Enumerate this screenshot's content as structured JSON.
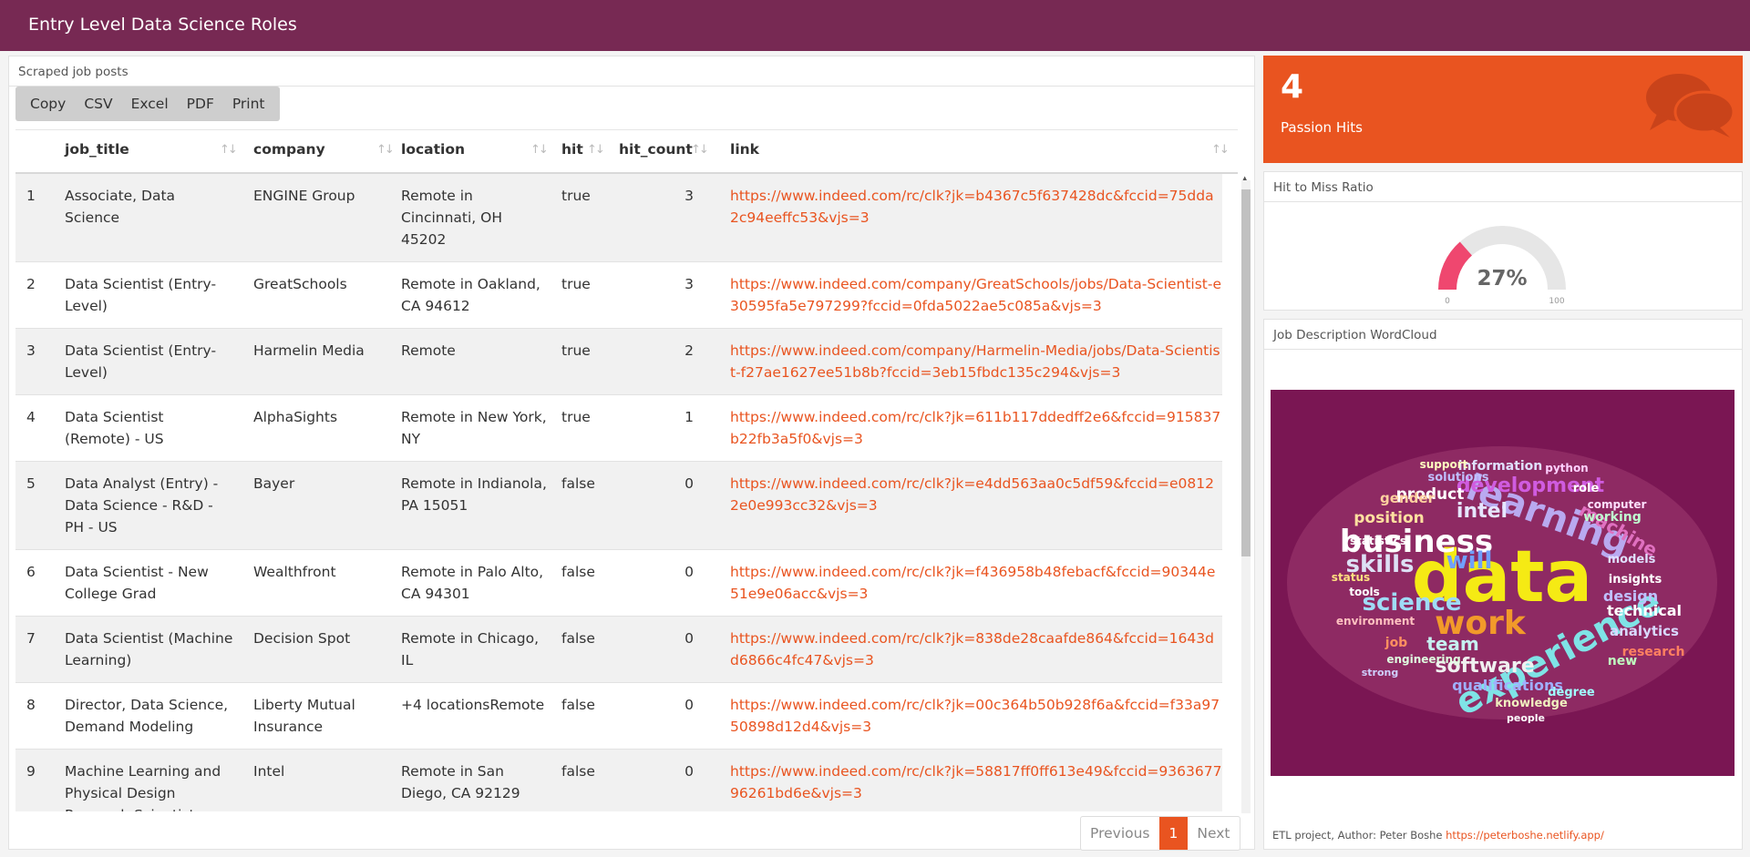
{
  "header": {
    "title": "Entry Level Data Science Roles"
  },
  "table_panel": {
    "title": "Scraped job posts",
    "buttons": [
      "Copy",
      "CSV",
      "Excel",
      "PDF",
      "Print"
    ],
    "columns": [
      "job_title",
      "company",
      "location",
      "hit",
      "hit_count",
      "link"
    ],
    "rows": [
      {
        "idx": "1",
        "job_title": "Associate, Data Science",
        "company": "ENGINE Group",
        "location": "Remote in Cincinnati, OH 45202",
        "hit": "true",
        "hit_count": "3",
        "link": "https://www.indeed.com/rc/clk?jk=b4367c5f637428dc&fccid=75dda2c94eeffc53&vjs=3"
      },
      {
        "idx": "2",
        "job_title": "Data Scientist (Entry-Level)",
        "company": "GreatSchools",
        "location": "Remote in Oakland, CA 94612",
        "hit": "true",
        "hit_count": "3",
        "link": "https://www.indeed.com/company/GreatSchools/jobs/Data-Scientist-e30595fa5e797299?fccid=0fda5022ae5c085a&vjs=3"
      },
      {
        "idx": "3",
        "job_title": "Data Scientist (Entry-Level)",
        "company": "Harmelin Media",
        "location": "Remote",
        "hit": "true",
        "hit_count": "2",
        "link": "https://www.indeed.com/company/Harmelin-Media/jobs/Data-Scientist-f27ae1627ee51b8b?fccid=3eb15fbdc135c294&vjs=3"
      },
      {
        "idx": "4",
        "job_title": "Data Scientist (Remote) - US",
        "company": "AlphaSights",
        "location": "Remote in New York, NY",
        "hit": "true",
        "hit_count": "1",
        "link": "https://www.indeed.com/rc/clk?jk=611b117ddedff2e6&fccid=915837b22fb3a5f0&vjs=3"
      },
      {
        "idx": "5",
        "job_title": "Data Analyst (Entry) - Data Science - R&D - PH - US",
        "company": "Bayer",
        "location": "Remote in Indianola, PA 15051",
        "hit": "false",
        "hit_count": "0",
        "link": "https://www.indeed.com/rc/clk?jk=e4dd563aa0c5df59&fccid=e08122e0e993cc32&vjs=3"
      },
      {
        "idx": "6",
        "job_title": "Data Scientist - New College Grad",
        "company": "Wealthfront",
        "location": "Remote in Palo Alto, CA 94301",
        "hit": "false",
        "hit_count": "0",
        "link": "https://www.indeed.com/rc/clk?jk=f436958b48febacf&fccid=90344e51e9e06acc&vjs=3"
      },
      {
        "idx": "7",
        "job_title": "Data Scientist (Machine Learning)",
        "company": "Decision Spot",
        "location": "Remote in Chicago, IL",
        "hit": "false",
        "hit_count": "0",
        "link": "https://www.indeed.com/rc/clk?jk=838de28caafde864&fccid=1643dd6866c4fc47&vjs=3"
      },
      {
        "idx": "8",
        "job_title": "Director, Data Science, Demand Modeling",
        "company": "Liberty Mutual Insurance",
        "location": "+4 locationsRemote",
        "hit": "false",
        "hit_count": "0",
        "link": "https://www.indeed.com/rc/clk?jk=00c364b50b928f6a&fccid=f33a9750898d12d4&vjs=3"
      },
      {
        "idx": "9",
        "job_title": "Machine Learning and Physical Design Research Scientist (Rem",
        "company": "Intel",
        "location": "Remote in San Diego, CA 92129",
        "hit": "false",
        "hit_count": "0",
        "link": "https://www.indeed.com/rc/clk?jk=58817ff0ff613e49&fccid=936367796261bd6e&vjs=3"
      }
    ],
    "pager": {
      "previous": "Previous",
      "current": "1",
      "next": "Next"
    }
  },
  "value_box": {
    "value": "4",
    "subtitle": "Passion Hits",
    "icon": "comments-icon"
  },
  "gauge_panel": {
    "title": "Hit to Miss Ratio",
    "value": 27,
    "label": "27%",
    "min": "0",
    "max": "100",
    "fill_color": "#ef476f"
  },
  "cloud_panel": {
    "title": "Job Description WordCloud",
    "words": [
      "data",
      "experience",
      "learning",
      "business",
      "work",
      "development",
      "skills",
      "team",
      "science",
      "software",
      "intel",
      "will",
      "position",
      "machine",
      "technical",
      "analytics",
      "information",
      "product",
      "qualifications",
      "knowledge",
      "design",
      "research",
      "gender",
      "tools",
      "working",
      "role",
      "models",
      "insights",
      "computer",
      "statistics",
      "solutions",
      "environment",
      "job",
      "new",
      "status",
      "degree",
      "engineering",
      "python",
      "support",
      "people",
      "strong"
    ],
    "background": "#7a1653"
  },
  "footer": {
    "text": "ETL project, Author: Peter Boshe",
    "link": "https://peterboshe.netlify.app/"
  }
}
